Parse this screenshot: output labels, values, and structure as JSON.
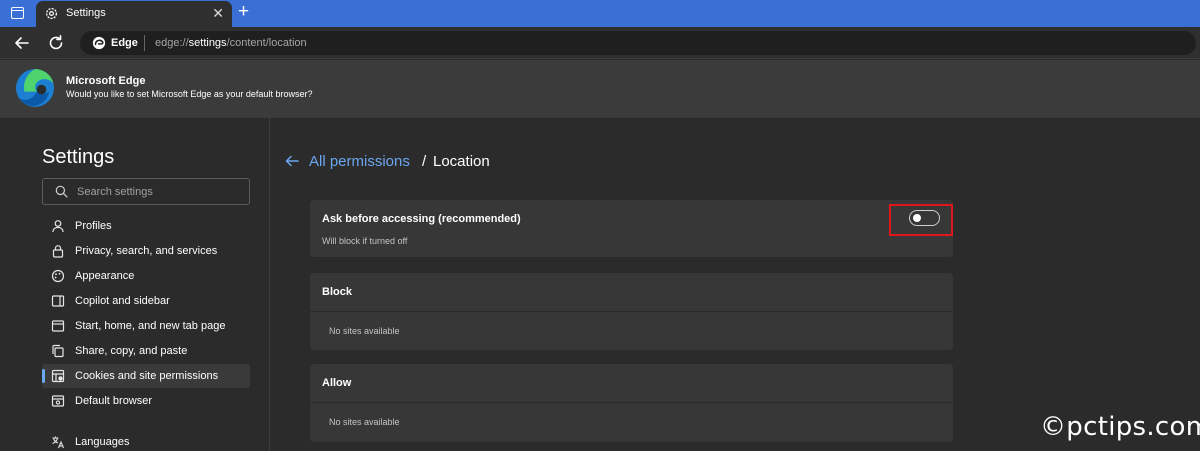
{
  "tab": {
    "title": "Settings",
    "close": "✕",
    "new_tab": "+"
  },
  "address": {
    "brand": "Edge",
    "url_prefix": "edge://",
    "url_bold": "settings",
    "url_suffix": "/content/location"
  },
  "banner": {
    "title": "Microsoft Edge",
    "message": "Would you like to set Microsoft Edge as your default browser?"
  },
  "sidebar": {
    "heading": "Settings",
    "search_placeholder": "Search settings",
    "items": [
      {
        "label": "Profiles",
        "icon": "profile-icon",
        "active": false
      },
      {
        "label": "Privacy, search, and services",
        "icon": "lock-icon",
        "active": false
      },
      {
        "label": "Appearance",
        "icon": "appearance-icon",
        "active": false
      },
      {
        "label": "Copilot and sidebar",
        "icon": "sidebar-icon",
        "active": false
      },
      {
        "label": "Start, home, and new tab page",
        "icon": "home-icon",
        "active": false
      },
      {
        "label": "Share, copy, and paste",
        "icon": "share-icon",
        "active": false
      },
      {
        "label": "Cookies and site permissions",
        "icon": "cookies-icon",
        "active": true
      },
      {
        "label": "Default browser",
        "icon": "browser-icon",
        "active": false
      },
      {
        "label": "Languages",
        "icon": "languages-icon",
        "active": false
      }
    ]
  },
  "main": {
    "breadcrumb_link": "All permissions",
    "breadcrumb_sep": "/",
    "breadcrumb_current": "Location",
    "ask_card": {
      "title": "Ask before accessing (recommended)",
      "subtitle": "Will block if turned off",
      "toggle_on": false
    },
    "block_card": {
      "title": "Block",
      "empty": "No sites available"
    },
    "allow_card": {
      "title": "Allow",
      "empty": "No sites available"
    }
  },
  "watermark": "©pctips.com",
  "colors": {
    "tab_strip": "#3a6fd6",
    "link": "#6ba7f0",
    "highlight": "#e0171a",
    "background": "#2b2b2b",
    "card": "#373737"
  }
}
